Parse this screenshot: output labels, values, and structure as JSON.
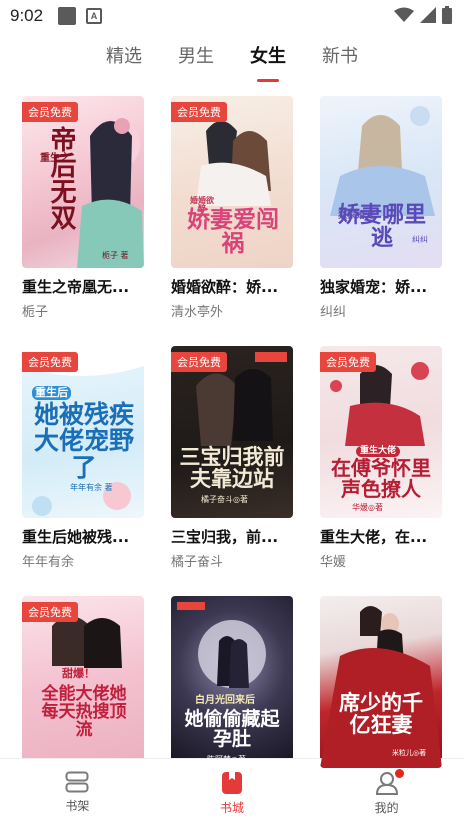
{
  "status_bar": {
    "time": "9:02",
    "notification_badge": "A"
  },
  "tabs": [
    {
      "label": "精选",
      "active": false
    },
    {
      "label": "男生",
      "active": false
    },
    {
      "label": "女生",
      "active": true
    },
    {
      "label": "新书",
      "active": false
    }
  ],
  "badge_text": "会员免费",
  "books": [
    {
      "title": "重生之帝凰无...",
      "author": "栀子",
      "cover_text": "帝后无双",
      "cover_sub": "重生之",
      "cover_author": "栀子 著",
      "badge": true
    },
    {
      "title": "婚婚欲醉：娇...",
      "author": "清水亭外",
      "cover_text": "娇妻爱闯祸",
      "cover_sub": "婚婚欲醉",
      "cover_author": "",
      "badge": true
    },
    {
      "title": "独家婚宠：娇...",
      "author": "纠纠",
      "cover_text": "娇妻哪里逃",
      "cover_sub": "独家婚宠",
      "cover_author": "纠纠",
      "badge": false
    },
    {
      "title": "重生后她被残...",
      "author": "年年有余",
      "cover_text": "她被残疾大佬宠野了",
      "cover_sub": "重生后",
      "cover_author": "年年有余 著",
      "badge": true
    },
    {
      "title": "三宝归我，前...",
      "author": "橘子奋斗",
      "cover_text": "三宝归我前夫靠边站",
      "cover_sub": "",
      "cover_author": "橘子奋斗◎著",
      "badge": true
    },
    {
      "title": "重生大佬，在...",
      "author": "华媛",
      "cover_text": "在傅爷怀里声色撩人",
      "cover_sub": "重生大佬",
      "cover_author": "华媛◎著",
      "badge": true
    },
    {
      "title": "",
      "author": "",
      "cover_text": "全能大佬她每天热搜顶流",
      "cover_sub": "甜爆！",
      "cover_author": "",
      "badge": true
    },
    {
      "title": "",
      "author": "",
      "cover_text": "她偷偷藏起孕肚",
      "cover_sub": "白月光回来后",
      "cover_author": "陈阿楚◎著",
      "badge": false
    },
    {
      "title": "",
      "author": "",
      "cover_text": "席少的千亿狂妻",
      "cover_sub": "",
      "cover_author": "米粒儿◎著",
      "badge": false
    }
  ],
  "bottom_nav": [
    {
      "label": "书架",
      "icon": "bookshelf-icon",
      "active": false
    },
    {
      "label": "书城",
      "icon": "bookstore-icon",
      "active": true
    },
    {
      "label": "我的",
      "icon": "profile-icon",
      "active": false
    }
  ],
  "colors": {
    "accent": "#e53a3a",
    "badge_bg": "#e8463d"
  }
}
